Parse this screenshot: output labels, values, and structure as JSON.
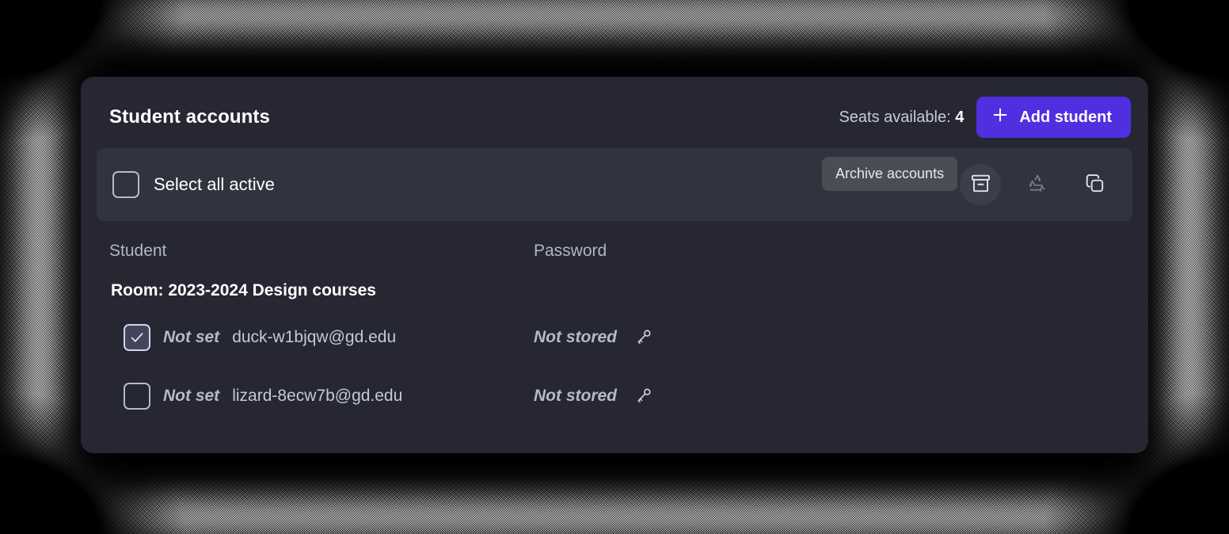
{
  "panel": {
    "title": "Student accounts",
    "seats_label": "Seats available:",
    "seats_count": "4",
    "add_student_label": "Add student",
    "plus_icon": "plus-icon"
  },
  "toolbar": {
    "select_all_label": "Select all active",
    "select_all_checked": false,
    "actions": [
      {
        "name": "archive-accounts-button",
        "icon": "archive-icon",
        "state": "hovered",
        "tooltip": "Archive accounts"
      },
      {
        "name": "recycle-accounts-button",
        "icon": "recycle-icon",
        "state": "disabled"
      },
      {
        "name": "copy-accounts-button",
        "icon": "copy-icon",
        "state": "normal"
      }
    ]
  },
  "tooltip": {
    "text": "Archive accounts"
  },
  "table": {
    "columns": [
      "Student",
      "Password"
    ],
    "groups": [
      {
        "label": "Room: 2023-2024 Design courses",
        "rows": [
          {
            "checked": true,
            "name_status": "Not set",
            "email": "duck-w1bjqw@gd.edu",
            "password_status": "Not stored",
            "password_icon": "key-icon"
          },
          {
            "checked": false,
            "name_status": "Not set",
            "email": "lizard-8ecw7b@gd.edu",
            "password_status": "Not stored",
            "password_icon": "key-icon"
          }
        ]
      }
    ]
  },
  "colors": {
    "accent": "#4f2fe0",
    "card_bg": "#262733",
    "toolbar_bg": "#31333f",
    "tooltip_bg": "#4b4d55",
    "muted_text": "#b4b6c2"
  }
}
